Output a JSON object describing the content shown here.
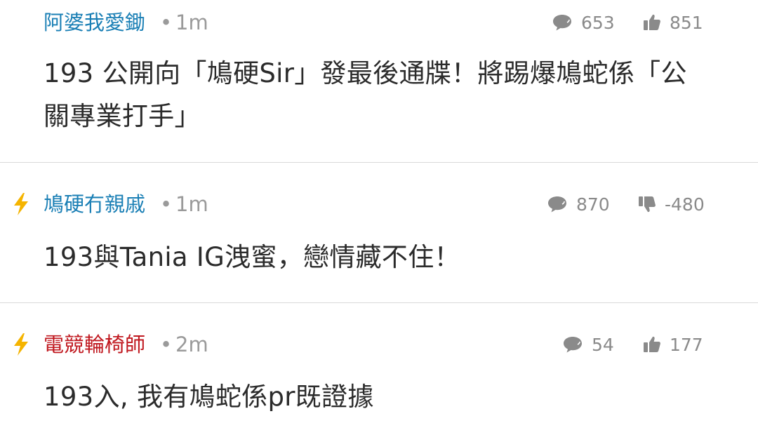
{
  "threads": [
    {
      "author": "阿婆我愛鋤",
      "author_color": "#1a7fb5",
      "separator": "•",
      "time": "1m",
      "replies": "653",
      "votes": "851",
      "vote_icon": "thumbs-up-icon",
      "hot": false,
      "title": "193 公開向「鳩硬Sir」發最後通牒！將踢爆鳩蛇係「公關專業打手」"
    },
    {
      "author": "鳩硬冇親戚",
      "author_color": "#1a7fb5",
      "separator": "•",
      "time": "1m",
      "replies": "870",
      "votes": "-480",
      "vote_icon": "thumbs-down-icon",
      "hot": true,
      "title": "193與Tania IG洩蜜，戀情藏不住！"
    },
    {
      "author": "電競輪椅師",
      "author_color": "#c0181f",
      "separator": "•",
      "time": "2m",
      "replies": "54",
      "votes": "177",
      "vote_icon": "thumbs-up-icon",
      "hot": true,
      "title": "193入, 我有鳩蛇係pr既證據"
    }
  ],
  "colors": {
    "bolt": "#f5b400",
    "muted": "#9a9a9a",
    "divider": "#d9d9d9"
  }
}
